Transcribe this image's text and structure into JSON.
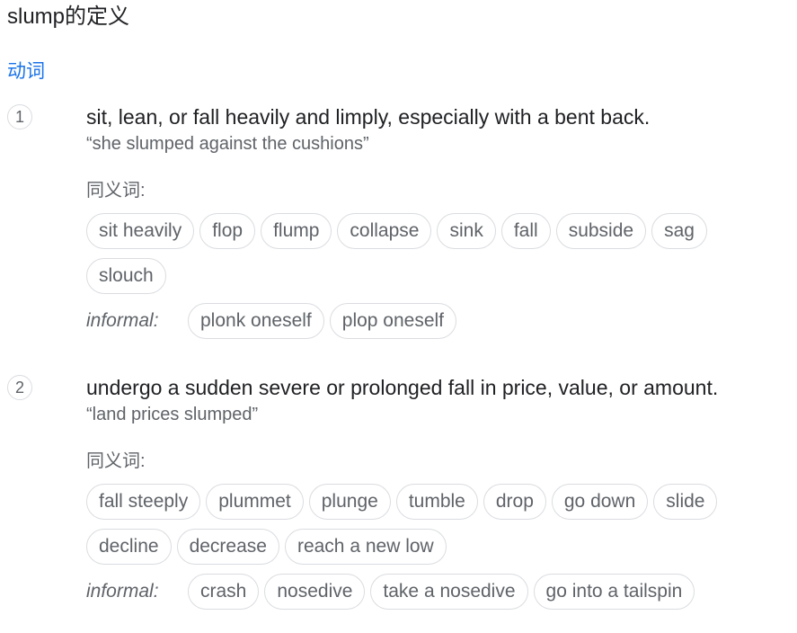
{
  "page": {
    "title": "slump的定义",
    "part_of_speech": "动词",
    "synonyms_label": "同义词:",
    "informal_label": "informal:"
  },
  "senses": [
    {
      "number": "1",
      "definition": "sit, lean, or fall heavily and limply, especially with a bent back.",
      "example": "“she slumped against the cushions”",
      "synonyms": [
        "sit heavily",
        "flop",
        "flump",
        "collapse",
        "sink",
        "fall",
        "subside",
        "sag",
        "slouch"
      ],
      "informal": [
        "plonk oneself",
        "plop oneself"
      ]
    },
    {
      "number": "2",
      "definition": "undergo a sudden severe or prolonged fall in price, value, or amount.",
      "example": "“land prices slumped”",
      "synonyms": [
        "fall steeply",
        "plummet",
        "plunge",
        "tumble",
        "drop",
        "go down",
        "slide",
        "decline",
        "decrease",
        "reach a new low"
      ],
      "informal": [
        "crash",
        "nosedive",
        "take a nosedive",
        "go into a tailspin"
      ]
    }
  ]
}
